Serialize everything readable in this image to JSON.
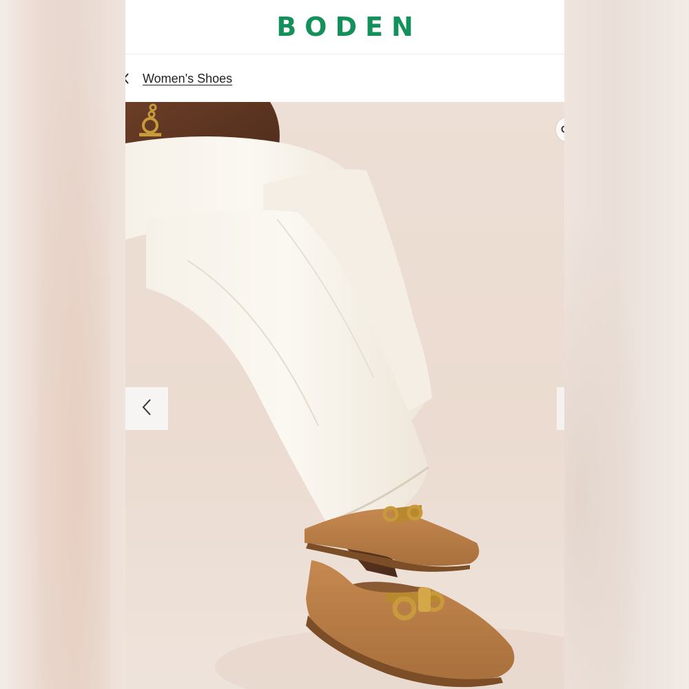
{
  "brand": {
    "logo_text": "BODEN",
    "color": "#14915a"
  },
  "breadcrumb": {
    "link_label": "Women's Shoes"
  },
  "gallery": {
    "image_subject": "woman in white wide-leg jeans wearing tan suede loafers with gold snaffle hardware",
    "prev_icon": "chevron-left-icon",
    "next_icon": "chevron-right-icon",
    "zoom_icon": "magnifier-icon",
    "zoom_glyph": "Q"
  }
}
